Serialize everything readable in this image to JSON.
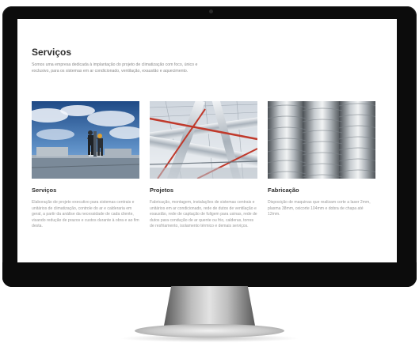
{
  "page": {
    "title": "Serviços",
    "intro": "Somos uma empresa dedicada à implantação do projeto de climatização com foco, único e exclusivo, para os sistemas em ar condicionado, ventilação, exaustão e aquecimento."
  },
  "cards": [
    {
      "title": "Serviços",
      "description": "Elaboração de projeto executivo para sistemas centrais e unitários de climatização, controle do ar e calderaria em geral, a partir da análise da necessidade de cada cliente, visando redução de prazos e custos durante à obra e ao fim desta.",
      "image": "workers-on-rooftop-sky-photo"
    },
    {
      "title": "Projetos",
      "description": "Fabricação, montagem, instalações de sistemas centrais e unitários em ar condicionado, rede de dutos de ventilação e exaustão, rede de captação de fuligem para usinas, rede de dutos para condução de ar quente ou frio, calderas, torres de resfriamento, isolamento térmico e demais serviços.",
      "image": "industrial-ducts-ceiling-photo"
    },
    {
      "title": "Fabricação",
      "description": "Disposição de maquinas que realizam corte a laser 2mm, plasma 38mm, oxicorte 104mm e dobra de chapa até 12mm.",
      "image": "spiral-metal-ducts-photo"
    }
  ],
  "colors": {
    "bezel": "#0c0c0c",
    "title": "#2e2e2e",
    "text": "#9a9a9a",
    "duct_red": "#c0392b"
  }
}
